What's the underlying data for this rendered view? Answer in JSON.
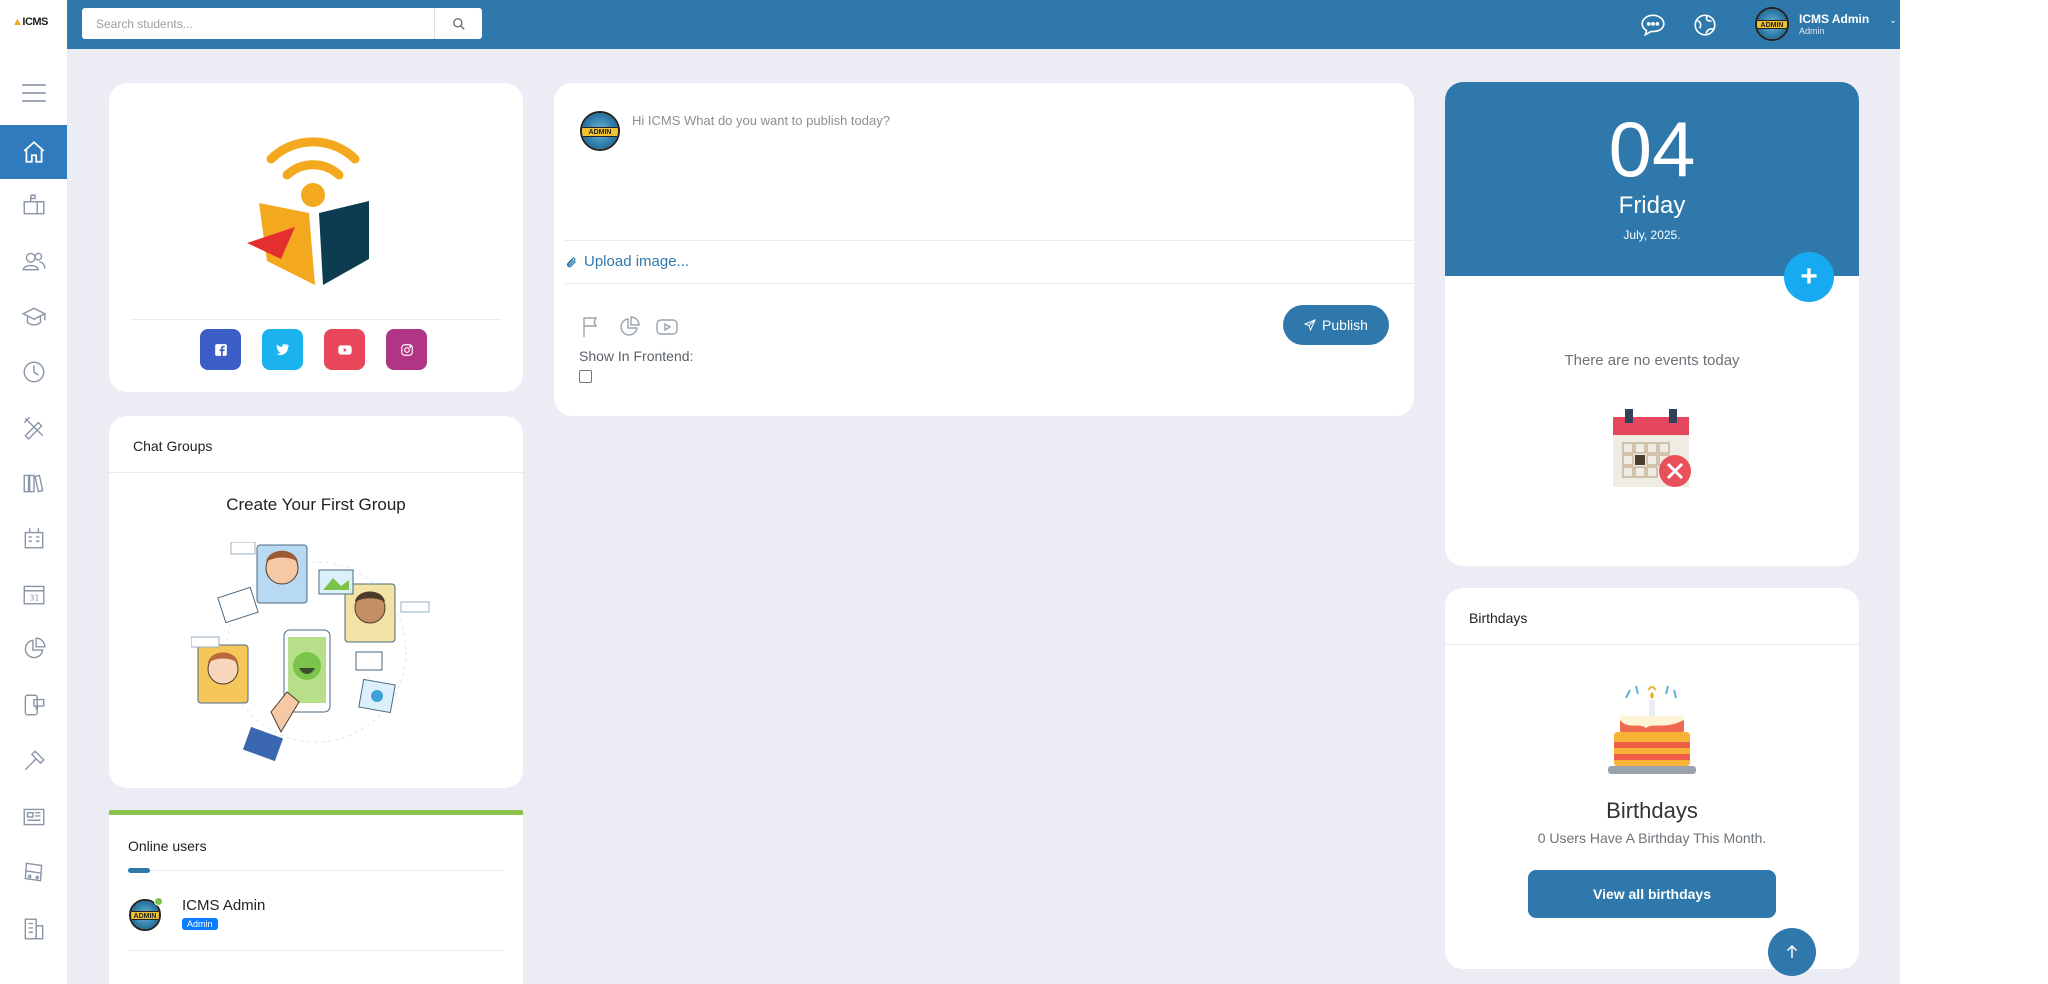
{
  "app": {
    "logo_text": "ICMS"
  },
  "search": {
    "placeholder": "Search students..."
  },
  "user": {
    "name": "ICMS Admin",
    "role": "Admin",
    "avatar_text": "ADMIN"
  },
  "post": {
    "placeholder": "Hi ICMS What do you want to publish today?",
    "upload_label": "Upload image...",
    "publish_label": "Publish",
    "show_frontend_label": "Show In Frontend:",
    "show_frontend_checked": false
  },
  "calendar": {
    "day": "04",
    "weekday": "Friday",
    "month_year": "July, 2025.",
    "no_events": "There are no events today"
  },
  "chat_groups": {
    "title": "Chat Groups",
    "create_label": "Create Your First Group"
  },
  "online_users": {
    "title": "Online users",
    "users": [
      {
        "name": "ICMS Admin",
        "role": "Admin"
      }
    ]
  },
  "birthdays": {
    "header": "Birthdays",
    "title": "Birthdays",
    "subtitle": "0 Users Have A Birthday This Month.",
    "button_label": "View all birthdays"
  },
  "social": [
    "facebook-icon",
    "twitter-icon",
    "youtube-icon",
    "instagram-icon"
  ],
  "colors": {
    "primary": "#2f78ab",
    "accent": "#18aaf0",
    "background": "#ececf4",
    "online_bar": "#8bc34a"
  }
}
